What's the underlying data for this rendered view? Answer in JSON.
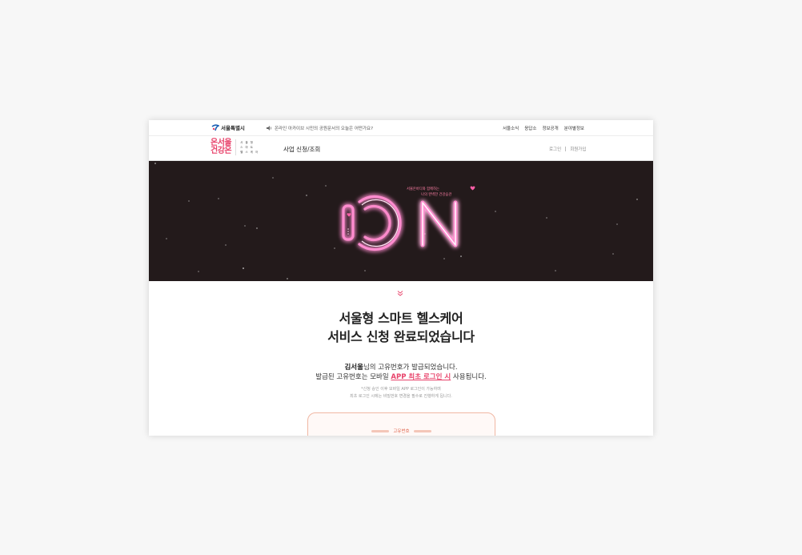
{
  "util_bar": {
    "city_name": "서울특별시",
    "notice": "온라인 아카이브 시민의 공원문서의 오늘은 어떤가요?",
    "links": [
      "서울소식",
      "응답소",
      "정보공개",
      "분야별정보"
    ]
  },
  "header": {
    "brand_line1": "온서울",
    "brand_line2": "건강온",
    "brand_sub": [
      "서 울 형",
      "스 마 트",
      "헬 스 케 어"
    ],
    "menu_item": "사업 신청/조회",
    "login": "로그인",
    "signup": "회원가입"
  },
  "banner": {
    "logo_text_n": "N",
    "tagline1": "서울온바디와 함께하는",
    "tagline2": "나의 완벽한 건강습관"
  },
  "content": {
    "headline_line1": "서울형 스마트 헬스케어",
    "headline_line2": "서비스 신청 완료되었습니다",
    "user_name": "김서울",
    "msg_line1_suffix": "님의 고유번호가 발급되었습니다.",
    "msg_line2_prefix": "발급된 고유번호는 모바일 ",
    "msg_line2_highlight": "APP 최초 로그인 시",
    "msg_line2_suffix": " 사용됩니다.",
    "fine_line1": "*신청 승인 이후 모바일 APP 로그인이 가능하며",
    "fine_line2": "최초 로그인 시에는 비밀번호 변경을 필수로 진행하게 됩니다.",
    "id_label": "고유번호"
  },
  "colors": {
    "accent": "#e8436b",
    "banner_bg": "#231a1b",
    "neon": "#ff7fbf"
  }
}
